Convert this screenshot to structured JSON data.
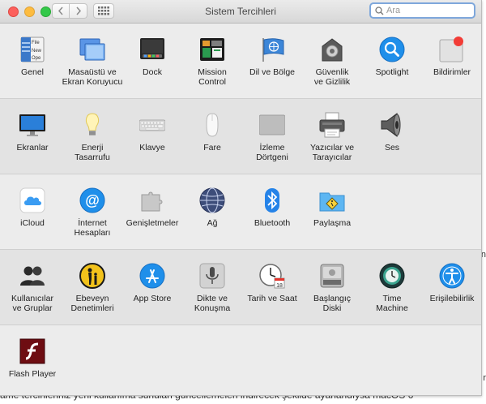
{
  "window": {
    "title": "Sistem Tercihleri",
    "search_placeholder": "Ara"
  },
  "background": {
    "visible_text": "ame tercihleriniz yeni kullanıma sunulan güncellemeleri indirecek şekilde ayarlandıysa macOS 6",
    "edge_glyph_1": "n",
    "edge_glyph_2": "r"
  },
  "rows": [
    {
      "items": [
        {
          "id": "genel",
          "label": "Genel",
          "icon": "general-icon"
        },
        {
          "id": "masaustu",
          "label": "Masaüstü ve\nEkran Koruyucu",
          "icon": "desktop-icon"
        },
        {
          "id": "dock",
          "label": "Dock",
          "icon": "dock-icon"
        },
        {
          "id": "mission",
          "label": "Mission\nControl",
          "icon": "mission-control-icon"
        },
        {
          "id": "dil",
          "label": "Dil ve Bölge",
          "icon": "language-region-icon"
        },
        {
          "id": "guvenlik",
          "label": "Güvenlik\nve Gizlilik",
          "icon": "security-icon"
        },
        {
          "id": "spotlight",
          "label": "Spotlight",
          "icon": "spotlight-icon"
        },
        {
          "id": "bildirimler",
          "label": "Bildirimler",
          "icon": "notifications-icon"
        }
      ]
    },
    {
      "items": [
        {
          "id": "ekranlar",
          "label": "Ekranlar",
          "icon": "displays-icon"
        },
        {
          "id": "enerji",
          "label": "Enerji\nTasarrufu",
          "icon": "energy-saver-icon"
        },
        {
          "id": "klavye",
          "label": "Klavye",
          "icon": "keyboard-icon"
        },
        {
          "id": "fare",
          "label": "Fare",
          "icon": "mouse-icon"
        },
        {
          "id": "izleme",
          "label": "İzleme\nDörtgeni",
          "icon": "trackpad-icon"
        },
        {
          "id": "yazicilar",
          "label": "Yazıcılar ve\nTarayıcılar",
          "icon": "printer-icon"
        },
        {
          "id": "ses",
          "label": "Ses",
          "icon": "sound-icon"
        }
      ]
    },
    {
      "items": [
        {
          "id": "icloud",
          "label": "iCloud",
          "icon": "icloud-icon"
        },
        {
          "id": "internet",
          "label": "İnternet\nHesapları",
          "icon": "internet-accounts-icon"
        },
        {
          "id": "genisletmeler",
          "label": "Genişletmeler",
          "icon": "extensions-icon"
        },
        {
          "id": "ag",
          "label": "Ağ",
          "icon": "network-icon"
        },
        {
          "id": "bluetooth",
          "label": "Bluetooth",
          "icon": "bluetooth-icon"
        },
        {
          "id": "paylasma",
          "label": "Paylaşma",
          "icon": "sharing-icon"
        }
      ]
    },
    {
      "items": [
        {
          "id": "kullanicilar",
          "label": "Kullanıcılar\nve Gruplar",
          "icon": "users-icon"
        },
        {
          "id": "ebeveyn",
          "label": "Ebeveyn\nDenetimleri",
          "icon": "parental-controls-icon"
        },
        {
          "id": "appstore",
          "label": "App Store",
          "icon": "app-store-icon"
        },
        {
          "id": "dikte",
          "label": "Dikte ve\nKonuşma",
          "icon": "dictation-icon"
        },
        {
          "id": "tarih",
          "label": "Tarih ve Saat",
          "icon": "date-time-icon",
          "calendar_day": "18"
        },
        {
          "id": "baslangic",
          "label": "Başlangıç\nDiski",
          "icon": "startup-disk-icon"
        },
        {
          "id": "timemachine",
          "label": "Time\nMachine",
          "icon": "time-machine-icon"
        },
        {
          "id": "erisilebilirlik",
          "label": "Erişilebilirlik",
          "icon": "accessibility-icon"
        }
      ]
    },
    {
      "items": [
        {
          "id": "flash",
          "label": "Flash Player",
          "icon": "flash-player-icon"
        }
      ]
    }
  ],
  "colors": {
    "accent_blue": "#1e8de6",
    "notification_badge": "#f23c36",
    "search_focus": "#7ea7db"
  }
}
